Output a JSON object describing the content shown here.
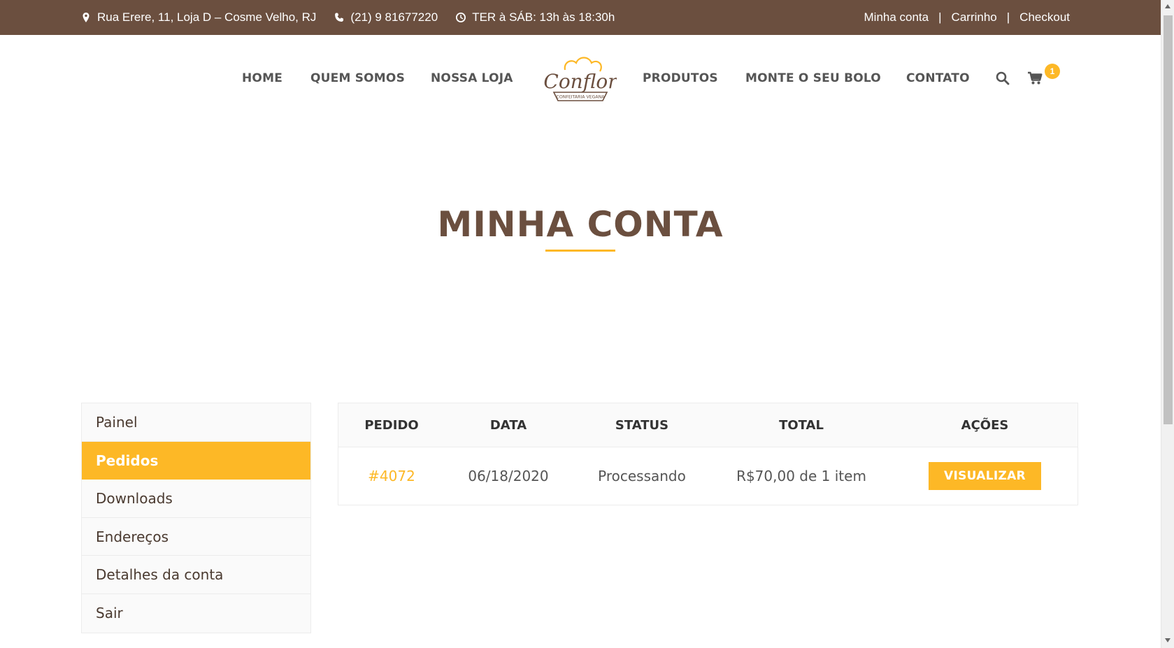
{
  "topbar": {
    "address": "Rua Erere, 11, Loja D – Cosme Velho, RJ",
    "phone": "(21) 9 81677220",
    "hours": "TER à SÁB: 13h às 18:30h",
    "links": [
      "Minha conta",
      "Carrinho",
      "Checkout"
    ],
    "separator": "|"
  },
  "nav": {
    "items": [
      "HOME",
      "QUEM SOMOS",
      "NOSSA LOJA",
      "PRODUTOS",
      "MONTE O SEU BOLO",
      "CONTATO"
    ],
    "logo_text": "Conflor",
    "logo_subtext": "CONFEITARIA VEGANA",
    "cart_count": "1"
  },
  "page": {
    "title": "MINHA CONTA"
  },
  "sidebar": {
    "items": [
      {
        "label": "Painel",
        "active": false
      },
      {
        "label": "Pedidos",
        "active": true
      },
      {
        "label": "Downloads",
        "active": false
      },
      {
        "label": "Endereços",
        "active": false
      },
      {
        "label": "Detalhes da conta",
        "active": false
      },
      {
        "label": "Sair",
        "active": false
      }
    ]
  },
  "orders": {
    "headers": [
      "PEDIDO",
      "DATA",
      "STATUS",
      "TOTAL",
      "AÇÕES"
    ],
    "rows": [
      {
        "order": "#4072",
        "date": "06/18/2020",
        "status": "Processando",
        "total": "R$70,00 de 1 item",
        "action": "VISUALIZAR"
      }
    ]
  },
  "colors": {
    "brand_brown": "#6b4f3f",
    "accent_yellow": "#fdb826"
  }
}
